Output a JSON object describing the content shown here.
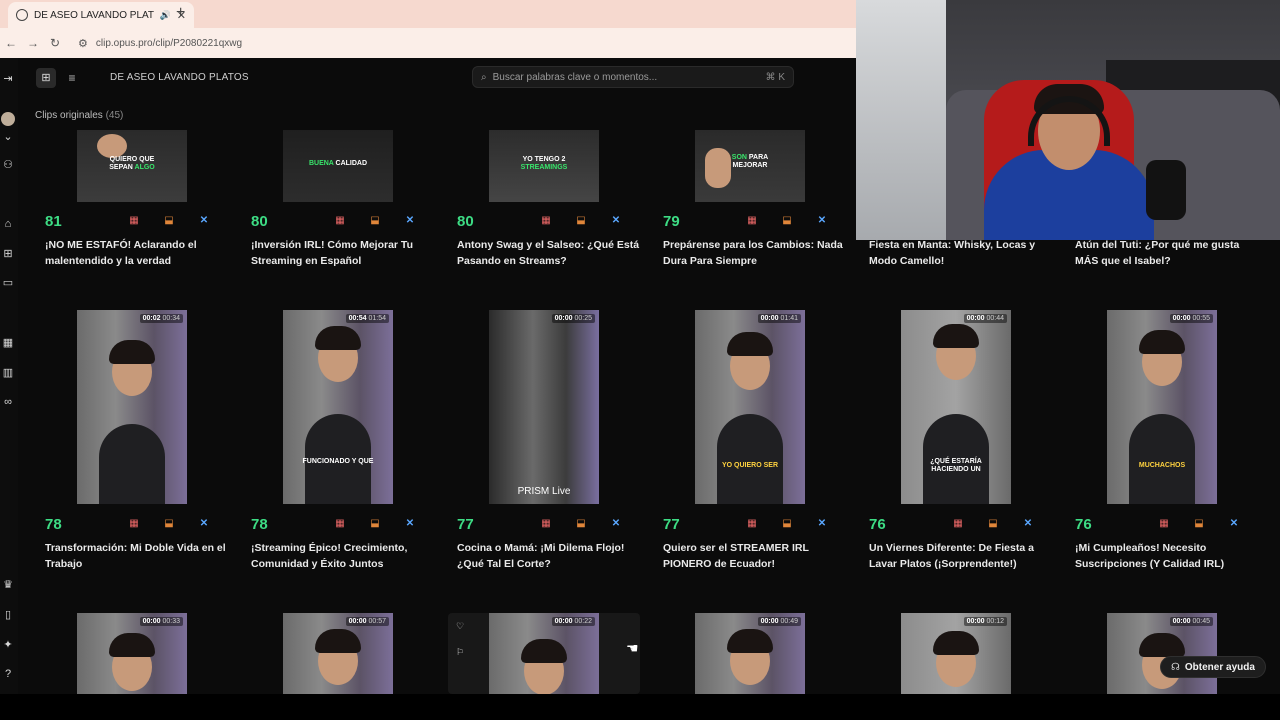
{
  "browser": {
    "tab_title": "DE ASEO LAVANDO PLATOS",
    "tab_close": "✕",
    "tab_audio": "🔊",
    "new_tab": "+",
    "url": "clip.opus.pro/clip/P2080221qxwg"
  },
  "header": {
    "project_title": "DE ASEO LAVANDO PLATOS",
    "search_placeholder": "Buscar palabras clave o momentos...",
    "search_shortcut": "⌘ K"
  },
  "section": {
    "label": "Clips originales",
    "count": "(45)"
  },
  "clips_row1": [
    {
      "score": "81",
      "title": "¡NO ME ESTAFÓ! Aclarando el malentendido y la verdad",
      "caption": [
        "QUIERO QUE",
        "SEPAN ",
        "ALGO"
      ]
    },
    {
      "score": "80",
      "title": "¡Inversión IRL! Cómo Mejorar Tu Streaming en Español",
      "caption": [
        "BUENA",
        " CALIDAD",
        ""
      ]
    },
    {
      "score": "80",
      "title": "Antony Swag y el Salseo: ¿Qué Está Pasando en Streams?",
      "caption": [
        "YO TENGO 2",
        "",
        "STREAMINGS"
      ]
    },
    {
      "score": "79",
      "title": "Prepárense para los Cambios: Nada Dura Para Siempre",
      "caption": [
        "SON",
        " PARA",
        "MEJORAR"
      ]
    },
    {
      "score": "",
      "title": "Fiesta en Manta: Whisky, Locas y Modo Camello!"
    },
    {
      "score": "",
      "title": "Atún del Tuti: ¿Por qué me gusta MÁS que el Isabel?"
    }
  ],
  "clips_row2": [
    {
      "score": "78",
      "elapsed": "00:02",
      "duration": "00:34",
      "title": "Transformación: Mi Doble Vida en el Trabajo",
      "caption": ""
    },
    {
      "score": "78",
      "elapsed": "00:54",
      "duration": "01:54",
      "title": "¡Streaming Épico! Crecimiento, Comunidad y Éxito Juntos",
      "caption": "FUNCIONADO Y QUE"
    },
    {
      "score": "77",
      "elapsed": "00:00",
      "duration": "00:25",
      "title": "Cocina o Mamá: ¡Mi Dilema Flojo! ¿Qué Tal El Corte?",
      "caption": "PRISM Live"
    },
    {
      "score": "77",
      "elapsed": "00:00",
      "duration": "01:41",
      "title": "Quiero ser el STREAMER IRL PIONERO de Ecuador!",
      "caption": "YO QUIERO SER"
    },
    {
      "score": "76",
      "elapsed": "00:00",
      "duration": "00:44",
      "title": "Un Viernes Diferente: De Fiesta a Lavar Platos (¡Sorprendente!)",
      "caption": "¿QUÉ ESTARÍA HACIENDO UN"
    },
    {
      "score": "76",
      "elapsed": "00:00",
      "duration": "00:55",
      "title": "¡Mi Cumpleaños! Necesito Suscripciones (Y Calidad IRL)",
      "caption": "MUCHACHOS"
    }
  ],
  "clips_row3": [
    {
      "elapsed": "00:00",
      "duration": "00:33"
    },
    {
      "elapsed": "00:00",
      "duration": "00:57"
    },
    {
      "elapsed": "00:00",
      "duration": "00:22"
    },
    {
      "elapsed": "00:00",
      "duration": "00:49"
    },
    {
      "elapsed": "00:00",
      "duration": "00:12"
    },
    {
      "elapsed": "00:00",
      "duration": "00:45"
    }
  ],
  "actions": {
    "calendar": "▦",
    "download": "⬓",
    "remove": "✕"
  },
  "help": {
    "label": "Obtener ayuda"
  },
  "colors": {
    "score": "#3ddc84",
    "accent_blue": "#5aa7ff",
    "highlight": "#39e56b"
  }
}
